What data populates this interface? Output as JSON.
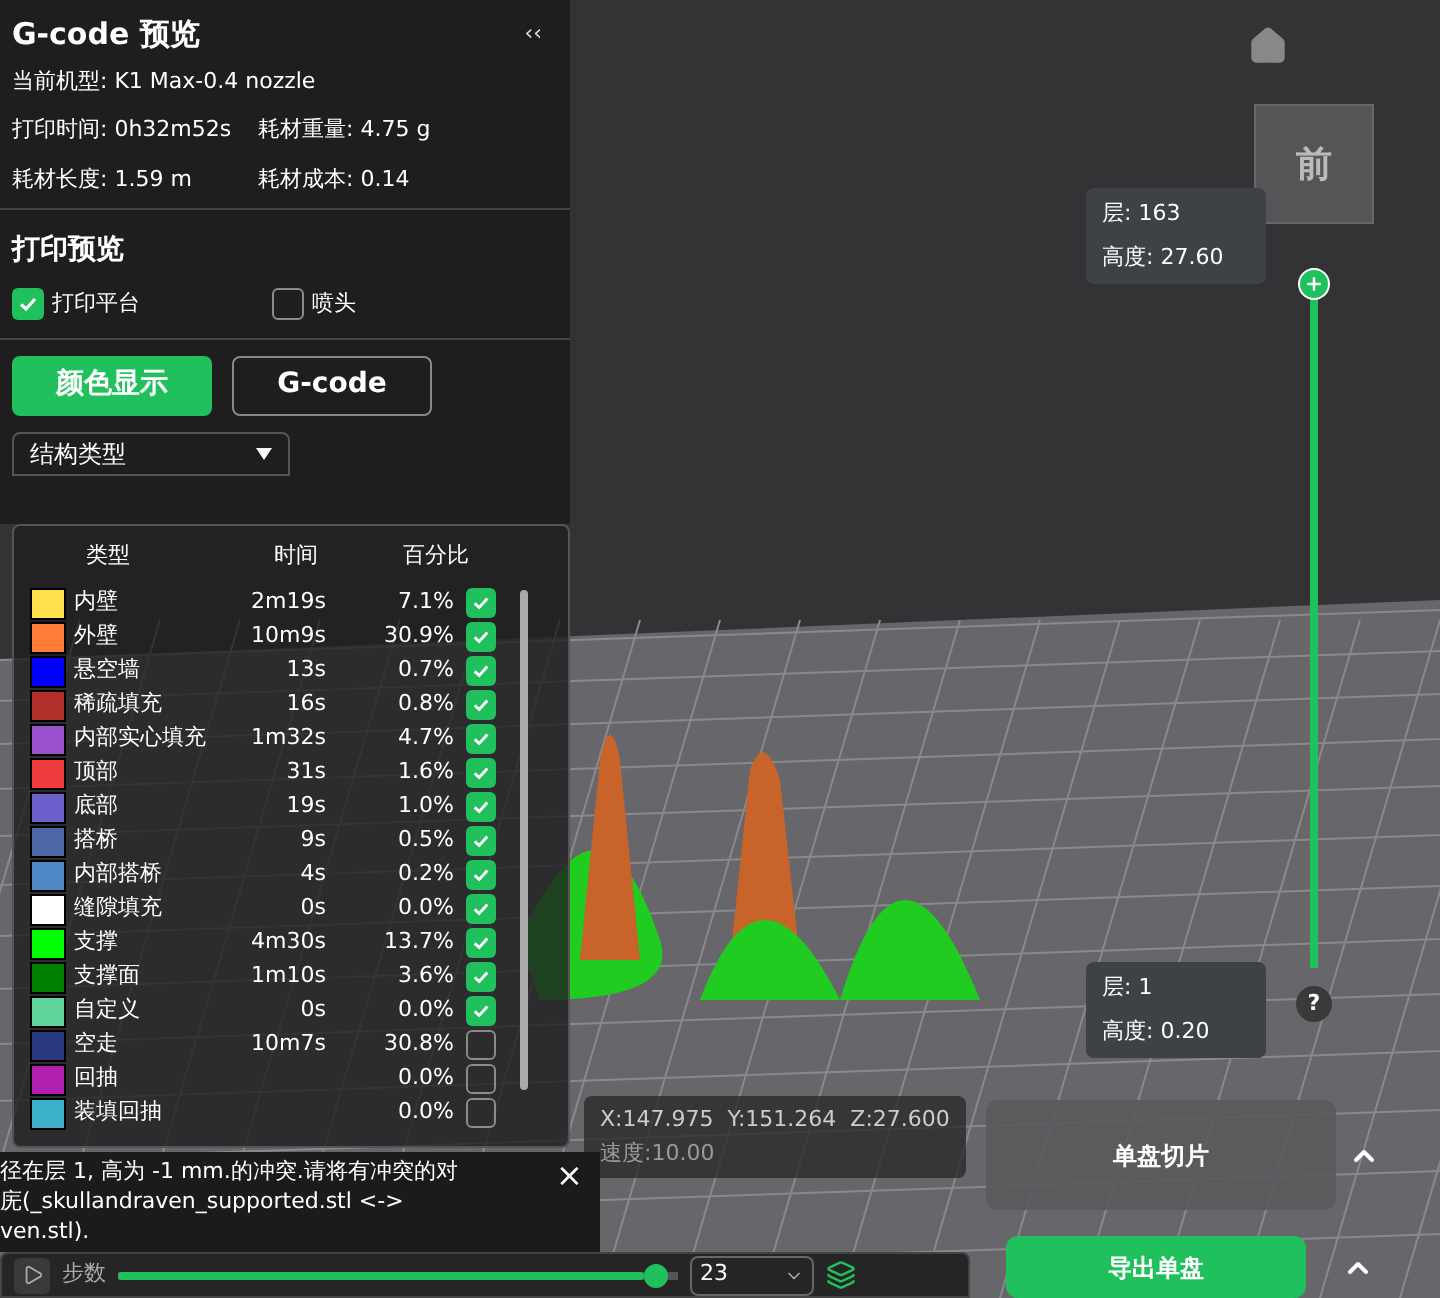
{
  "panel": {
    "title": "G-code 预览",
    "collapse": "‹‹",
    "machine": "当前机型: K1 Max-0.4 nozzle",
    "stats": [
      "打印时间: 0h32m52s",
      "耗材重量: 4.75 g",
      "耗材长度: 1.59 m",
      "耗材成本: 0.14"
    ]
  },
  "preview": {
    "title": "打印预览",
    "options": [
      {
        "label": "打印平台",
        "checked": true
      },
      {
        "label": "喷头",
        "checked": false
      }
    ]
  },
  "modes": [
    {
      "label": "颜色显示",
      "selected": true
    },
    {
      "label": "G-code",
      "selected": false
    }
  ],
  "view_type": {
    "value": "结构类型"
  },
  "legend": {
    "columns": [
      "类型",
      "时间",
      "百分比"
    ],
    "rows": [
      {
        "name": "内壁",
        "time": "2m19s",
        "percent": "7.1%",
        "color": "#ffe14d",
        "checked": true
      },
      {
        "name": "外壁",
        "time": "10m9s",
        "percent": "30.9%",
        "color": "#ff7d38",
        "checked": true
      },
      {
        "name": "悬空墙",
        "time": "13s",
        "percent": "0.7%",
        "color": "#0000ff",
        "checked": true
      },
      {
        "name": "稀疏填充",
        "time": "16s",
        "percent": "0.8%",
        "color": "#b03029",
        "checked": true
      },
      {
        "name": "内部实心填充",
        "time": "1m32s",
        "percent": "4.7%",
        "color": "#9a52cc",
        "checked": true
      },
      {
        "name": "顶部",
        "time": "31s",
        "percent": "1.6%",
        "color": "#f03c3c",
        "checked": true
      },
      {
        "name": "底部",
        "time": "19s",
        "percent": "1.0%",
        "color": "#6b5fcc",
        "checked": true
      },
      {
        "name": "搭桥",
        "time": "9s",
        "percent": "0.5%",
        "color": "#4d66a6",
        "checked": true
      },
      {
        "name": "内部搭桥",
        "time": "4s",
        "percent": "0.2%",
        "color": "#4d88c4",
        "checked": true
      },
      {
        "name": "缝隙填充",
        "time": "0s",
        "percent": "0.0%",
        "color": "#ffffff",
        "checked": true
      },
      {
        "name": "支撑",
        "time": "4m30s",
        "percent": "13.7%",
        "color": "#00ff00",
        "checked": true
      },
      {
        "name": "支撑面",
        "time": "1m10s",
        "percent": "3.6%",
        "color": "#008000",
        "checked": true
      },
      {
        "name": "自定义",
        "time": "0s",
        "percent": "0.0%",
        "color": "#5fd39a",
        "checked": true
      },
      {
        "name": "空走",
        "time": "10m7s",
        "percent": "30.8%",
        "color": "#2b3a80",
        "checked": false
      },
      {
        "name": "回抽",
        "percent": "0.0%",
        "color": "#b020b0",
        "checked": false
      },
      {
        "name": "装填回抽",
        "percent": "0.0%",
        "color": "#3cb0c8",
        "checked": false
      }
    ]
  },
  "position": {
    "coords": "X:147.975  Y:151.264  Z:27.600",
    "speed": "速度:10.00"
  },
  "toast": {
    "lines": [
      "径在层 1, 高为 -1 mm.的冲突.请将有冲突的对",
      "庑(_skullandraven_supported.stl <->",
      "ven.stl)."
    ],
    "close": "×"
  },
  "step_bar": {
    "label": "步数",
    "level": 0.98,
    "value": "23"
  },
  "view_cube": {
    "front": "前"
  },
  "layer_slider": {
    "level": 1,
    "top": {
      "layer": "层: 163",
      "height": "高度: 27.60"
    },
    "bottom": {
      "layer": "层: 1",
      "height": "高度: 0.20"
    },
    "help": "?"
  },
  "actions": [
    {
      "label": "单盘切片",
      "primary": false
    },
    {
      "label": "导出单盘",
      "primary": true
    }
  ]
}
